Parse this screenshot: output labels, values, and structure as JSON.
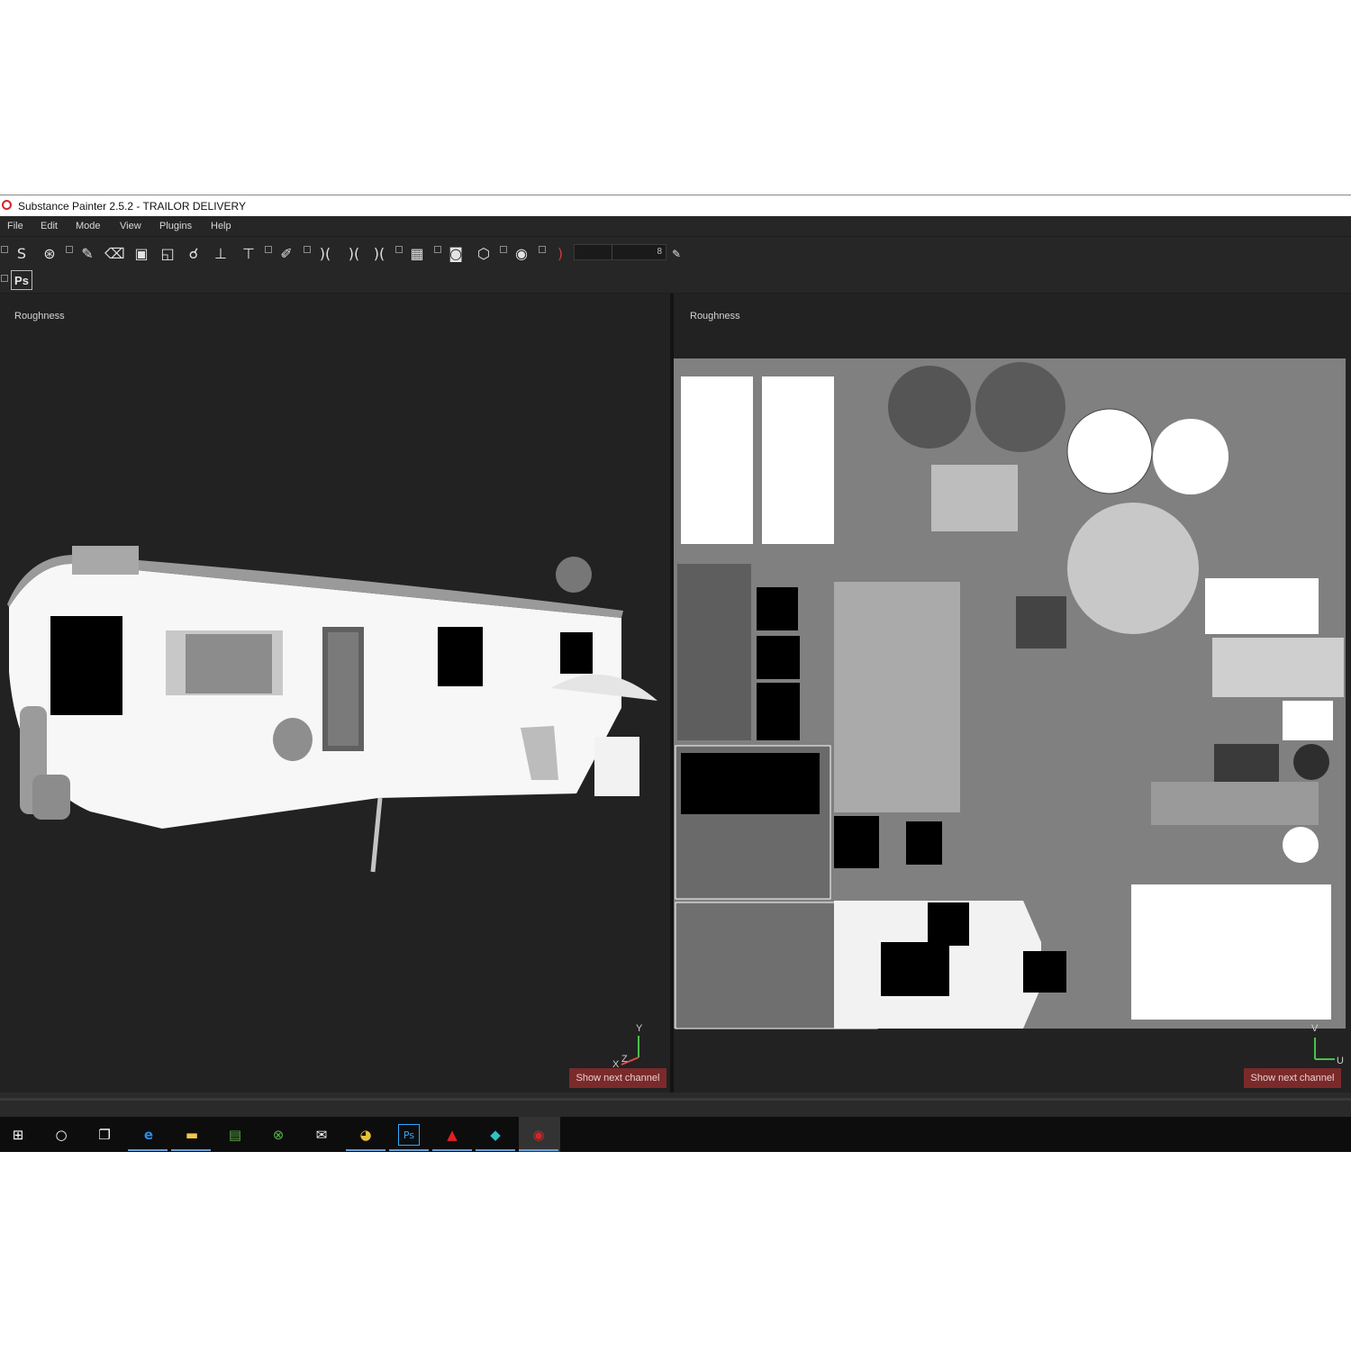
{
  "window": {
    "title": "Substance Painter 2.5.2 - TRAILOR DELIVERY"
  },
  "menu": [
    "File",
    "Edit",
    "Mode",
    "View",
    "Plugins",
    "Help"
  ],
  "toolbar": {
    "brush_size": "8",
    "ps_button": "Ps"
  },
  "viewport_3d": {
    "channel": "Roughness",
    "next_channel_label": "Show next channel",
    "axis": {
      "y": "Y",
      "x": "X",
      "z": "Z"
    }
  },
  "viewport_2d": {
    "channel": "Roughness",
    "next_channel_label": "Show next channel",
    "axis": {
      "v": "V",
      "u": "U"
    }
  },
  "colors": {
    "accent_red": "#7b2a2a",
    "brand": "#d2262a"
  }
}
